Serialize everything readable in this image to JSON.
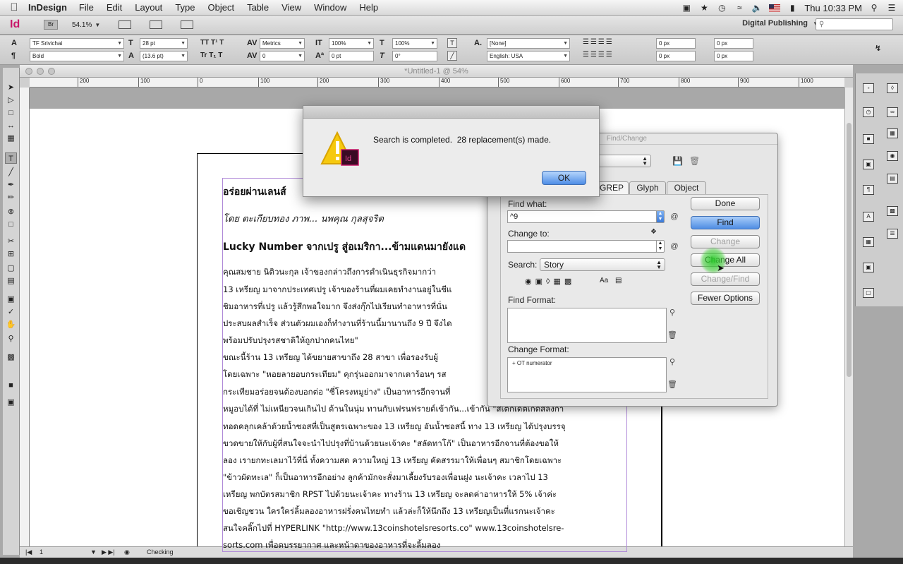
{
  "menubar": {
    "app_name": "InDesign",
    "items": [
      "File",
      "Edit",
      "Layout",
      "Type",
      "Object",
      "Table",
      "View",
      "Window",
      "Help"
    ],
    "clock": "Thu 10:33 PM"
  },
  "appbar": {
    "logo": "Id",
    "bridge": "Br",
    "zoom": "54.1%",
    "workspace": "Digital Publishing"
  },
  "control": {
    "font_family": "TF Srivichai",
    "font_style": "Bold",
    "font_size": "28 pt",
    "leading": "(13.6 pt)",
    "kerning": "Metrics",
    "tracking": "0",
    "v_scale": "100%",
    "h_scale": "100%",
    "baseline": "0 pt",
    "skew": "0°",
    "char_style": "[None]",
    "language": "English: USA",
    "indent_left": "0 px",
    "indent_right": "0 px",
    "indent_first": "0 px",
    "indent_last": "0 px"
  },
  "document": {
    "title": "*Untitled-1 @ 54%",
    "ruler_ticks": [
      "200",
      "100",
      "0",
      "100",
      "200",
      "300",
      "400",
      "500",
      "600",
      "700",
      "800",
      "900",
      "1000"
    ],
    "page_number": "1",
    "preflight": "Checking",
    "headline": "อร่อยผ่านเลนส์",
    "byline": "โดย ตะเกียบทอง  ภาพ... นพคุณ  กุลสุจริต",
    "subhead": "Lucky Number จากเปรู  สู่อเมริกา...ข้ามแดนมายังแด",
    "body_lines": [
      "      คุณสมชาย  นิติวนะกุล เจ้าของกล่าวถึงการดำเนินธุรกิจมากว่า",
      "13 เหรียญ มาจากประเทศเปรู เจ้าของร้านที่ผมเคยทำงานอยู่ในชีแ",
      "ชิมอาหารที่เปรู แล้วรู้สึกพอใจมาก จึงส่งกุ๊กไปเรียนทำอาหารที่นั่น",
      "ประสบผลสำเร็จ  ส่วนตัวผมเองก็ทำงานที่ร้านนี้มานานถึง 9 ปี จึงได",
      "พร้อมปรับปรุงรสชาติให้ถูกปากคนไทย\"",
      "      ขณะนี้ร้าน 13 เหรียญ ได้ขยายสาขาถึง 28 สาขา เพื่อรองรับผู้",
      "โดยเฉพาะ \"หอยลายอบกระเทียม\" คุกรุ่นออกมาจากเตาร้อนๆ  รส",
      "กระเทียมอร่อยจนต้องบอกต่อ  \"ซี่โครงหมูย่าง\" เป็นอาหารอีกจานที่",
      "หมูอบได้ที่ ไม่เหนียวจนเกินไป ด้านในนุ่ม ทานกับเฟรนฟรายด์เข้ากัน...เข้ากัน  \"สเต็กเดตเกดสลิงกา",
      "ทอดคลุกเคล้าด้วยน้ำซอสที่เป็นสูตรเฉพาะของ 13 เหรียญ  อันน้ำซอสนี้ ทาง 13 เหรียญ ได้ปรุงบรรจุ",
      "ขวดขายให้กับผู้ที่สนใจจะนำไปปรุงที่บ้านด้วยนะเจ้าคะ  \"สลัดทาโก้\"  เป็นอาหารอีกจานที่ต้องขอให้",
      "ลอง  เรายกทะเลมาไว้ที่นี่  ทั้งความสด ความใหญ่  13 เหรียญ คัดสรรมาให้เพื่อนๆ สมาชิกโดยเฉพาะ",
      "\"ข้าวผัดทะเล\" ก็เป็นอาหารอีกอย่าง ลูกค้ามักจะสั่งมาเลี้ยงรับรองเพื่อนฝูง นะเจ้าคะ  เวลาไป 13",
      "เหรียญ พกบัตรสมาชิก RPST ไปด้วยนะเจ้าคะ ทางร้าน 13 เหรียญ  จะลดค่าอาหารให้ 5%  เจ้าค่ะ",
      "      ขอเชิญชวน ใครใคร่ลิ้มลองอาหารฝรั่งคนไทยทำ  แล้วล่ะก็ให้นึกถึง 13 เหรียญเป็นที่แรกนะเจ้าคะ",
      "      สนใจคลิ๊กไปที่  HYPERLINK \"http://www.13coinshotelsresorts.co\" www.13coinshotelsre-",
      "sorts.com  เพื่อดบรรยากาศ และหน้าตาของอาหารที่จะลิ้มลอง"
    ]
  },
  "find_change": {
    "title": "Find/Change",
    "tabs": [
      "GREP",
      "Glyph",
      "Object"
    ],
    "find_what_label": "Find what:",
    "find_what_value": "^9",
    "change_to_label": "Change to:",
    "change_to_value": "",
    "search_label": "Search:",
    "search_value": "Story",
    "find_format_label": "Find Format:",
    "change_format_label": "Change Format:",
    "change_format_value": "+ OT numerator",
    "case_icon": "Aa",
    "buttons": {
      "done": "Done",
      "find": "Find",
      "change": "Change",
      "change_all": "Change All",
      "change_find": "Change/Find",
      "fewer_options": "Fewer Options"
    }
  },
  "alert": {
    "message": "Search is completed.  28 replacement(s) made.",
    "ok": "OK",
    "icon_badge": "Id"
  },
  "colors": {
    "indesign_pink": "#c8186a",
    "button_blue": "#4f8de3",
    "frame_purple": "#b08ad8",
    "cursor_glow": "#28c828"
  },
  "icons": [
    "apple-icon",
    "search-icon",
    "warning-icon",
    "wifi-icon",
    "volume-icon",
    "battery-icon",
    "list-icon"
  ]
}
